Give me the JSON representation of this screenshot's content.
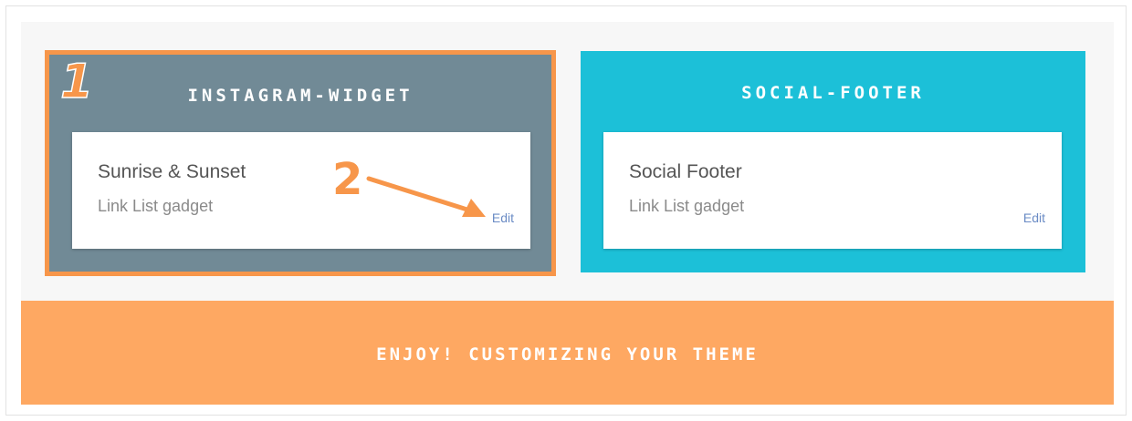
{
  "sections": [
    {
      "title": "INSTAGRAM-WIDGET",
      "gadget": {
        "title": "Sunrise & Sunset",
        "subtitle": "Link List gadget",
        "edit_label": "Edit"
      }
    },
    {
      "title": "SOCIAL-FOOTER",
      "gadget": {
        "title": "Social Footer",
        "subtitle": "Link List gadget",
        "edit_label": "Edit"
      }
    }
  ],
  "annotations": {
    "step_1": "1",
    "step_2": "2"
  },
  "footer": {
    "text": "ENJOY! CUSTOMIZING YOUR THEME"
  },
  "colors": {
    "instagram_section_bg": "#718a96",
    "highlight_orange": "#f7964a",
    "social_section_bg": "#1cc0d8",
    "footer_bg": "#fea862",
    "edit_link": "#6b8cc5"
  }
}
